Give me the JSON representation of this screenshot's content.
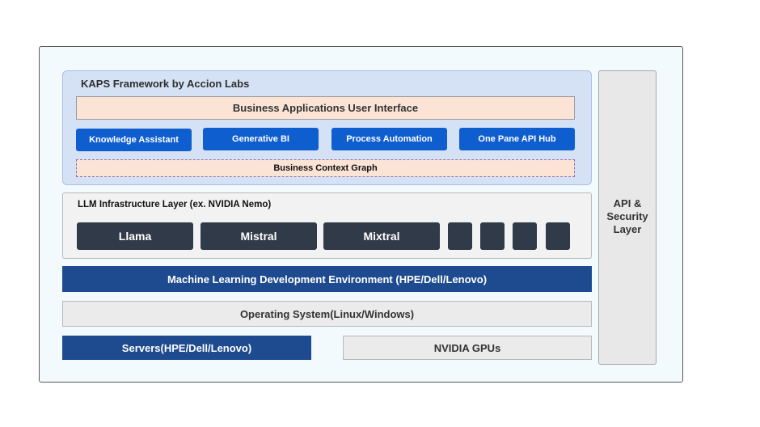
{
  "kaps": {
    "title": "KAPS Framework by Accion Labs",
    "ui_bar": "Business Applications User Interface",
    "modules": [
      "Knowledge Assistant",
      "Generative BI",
      "Process Automation",
      "One Pane API Hub"
    ],
    "context_graph": "Business Context Graph"
  },
  "llm": {
    "title": "LLM Infrastructure Layer (ex. NVIDIA Nemo)",
    "models": [
      "Llama",
      "Mistral",
      "Mixtral",
      "",
      "",
      "",
      ""
    ]
  },
  "mlde": "Machine Learning Development Environment (HPE/Dell/Lenovo)",
  "os": "Operating System(Linux/Windows)",
  "servers": "Servers(HPE/Dell/Lenovo)",
  "gpus": "NVIDIA GPUs",
  "api": "API &\nSecurity\nLayer",
  "colors": {
    "module_blue": "#0f5ed0",
    "model_dark": "#303a49",
    "navy": "#1e4b8f",
    "kaps_bg": "#d5e1f5",
    "peach": "#fbe4d6"
  }
}
